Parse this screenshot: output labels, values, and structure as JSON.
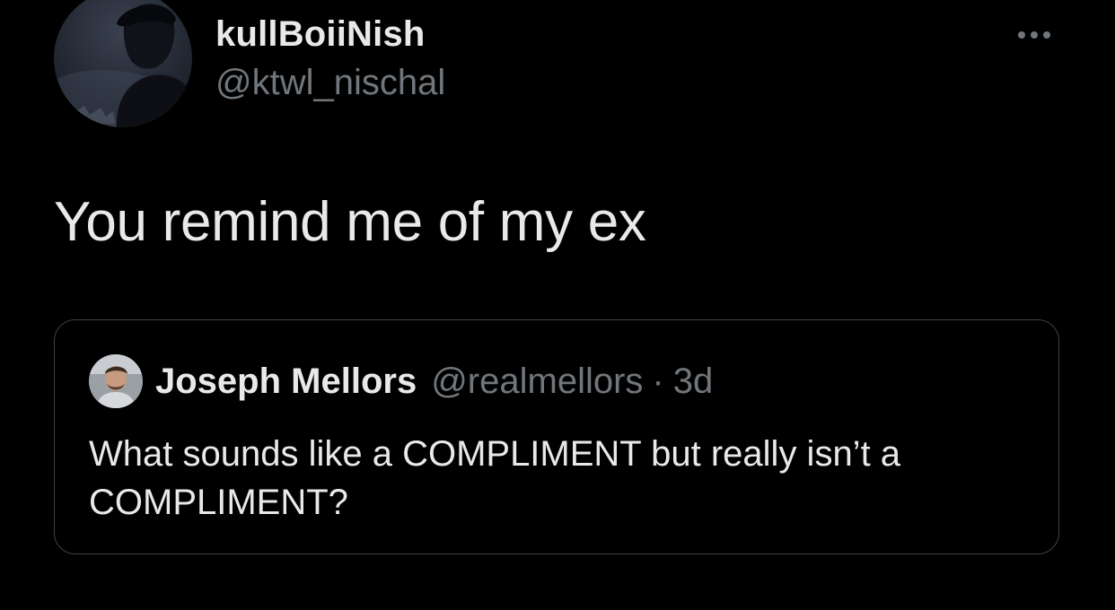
{
  "tweet": {
    "author": {
      "display_name": "kullBoiiNish",
      "handle": "@ktwl_nischal",
      "avatar_icon": "user-silhouette-avatar"
    },
    "more_icon": "more-horizontal-icon",
    "text": "You remind me of my ex"
  },
  "quoted_tweet": {
    "author": {
      "display_name": "Joseph Mellors",
      "handle": "@realmellors",
      "avatar_icon": "user-photo-avatar"
    },
    "separator": "·",
    "time": "3d",
    "text": "What sounds like a COMPLIMENT but really isn’t a COMPLIMENT?"
  },
  "colors": {
    "background": "#000000",
    "primary_text": "#e7e9ea",
    "secondary_text": "#71767b",
    "card_border": "#3e4144"
  }
}
